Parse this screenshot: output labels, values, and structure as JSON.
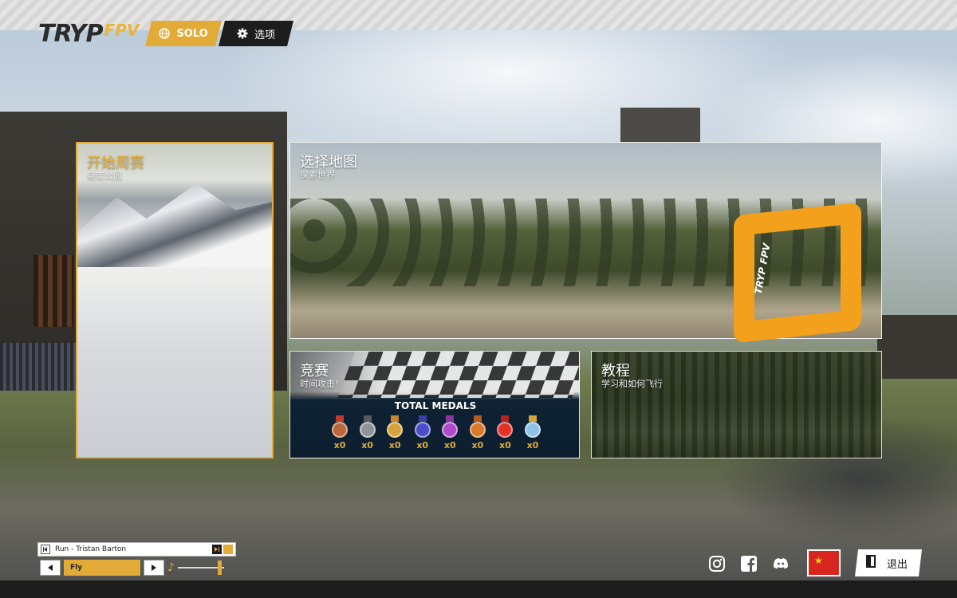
{
  "logo": {
    "main": "TRYP",
    "sub": "FPV"
  },
  "nav": {
    "solo_label": "SOLO",
    "options_label": "选项"
  },
  "cards": {
    "weekly": {
      "title": "开始周赛",
      "subtitle": "悬崖公园"
    },
    "map": {
      "title": "选择地图",
      "subtitle": "探索世界",
      "gate_text": "TRYP FPV"
    },
    "race": {
      "title": "竞赛",
      "subtitle": "时间攻击！",
      "medals_title": "TOTAL MEDALS",
      "medals": [
        {
          "icon": "bronze-medal",
          "color": "#b8673a",
          "ribbon": "#c0392b",
          "count": "x0"
        },
        {
          "icon": "silver-medal",
          "color": "#8e9499",
          "ribbon": "#555a60",
          "count": "x0"
        },
        {
          "icon": "gold-medal",
          "color": "#d6a23a",
          "ribbon": "#c9852a",
          "count": "x0"
        },
        {
          "icon": "sapphire-medal",
          "color": "#4a4fc9",
          "ribbon": "#3a3fa0",
          "count": "x0"
        },
        {
          "icon": "amethyst-medal",
          "color": "#b04ac8",
          "ribbon": "#8a35a0",
          "count": "x0"
        },
        {
          "icon": "copper-medal",
          "color": "#d9792a",
          "ribbon": "#b55a1e",
          "count": "x0"
        },
        {
          "icon": "ruby-medal",
          "color": "#e2332a",
          "ribbon": "#b8221c",
          "count": "x0"
        },
        {
          "icon": "diamond-medal",
          "color": "#8fc4e8",
          "ribbon": "#d6a23a",
          "count": "x0"
        }
      ]
    },
    "tutorial": {
      "title": "教程",
      "subtitle": "学习和如何飞行"
    }
  },
  "player": {
    "track": "Run - Tristan Barton",
    "genre": "Fly",
    "volume": 0.95
  },
  "footer": {
    "social": [
      "instagram-icon",
      "facebook-icon",
      "discord-icon"
    ],
    "language_flag": "china-flag-icon",
    "exit_label": "退出"
  },
  "colors": {
    "accent": "#e2ab38",
    "dark": "#1d1d1d"
  }
}
